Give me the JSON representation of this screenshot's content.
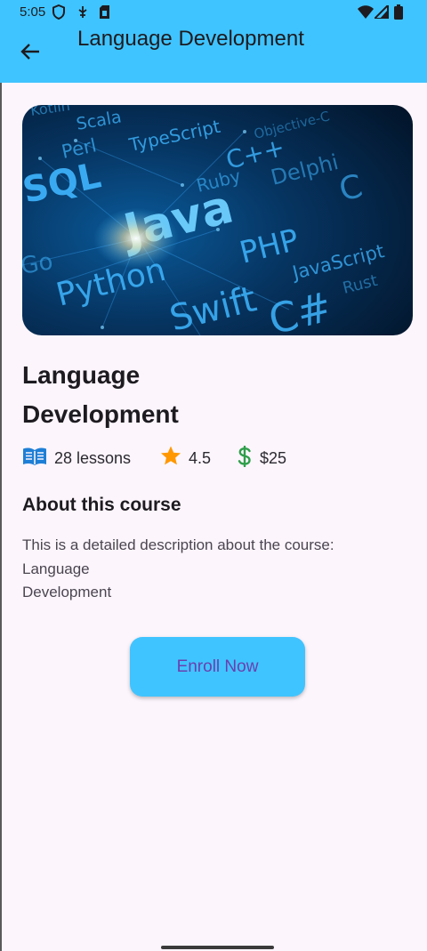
{
  "status_bar": {
    "time": "5:05",
    "icons": [
      "vpn-shield-icon",
      "usb-debug-icon",
      "sim-card-icon",
      "wifi-icon",
      "signal-icon",
      "battery-icon"
    ]
  },
  "app_bar": {
    "back_icon": "arrow-back-icon",
    "title": "Language Development"
  },
  "hero_image": {
    "keywords": [
      "Scala",
      "Perl",
      "TypeScript",
      "C++",
      "SQL",
      "Ruby",
      "Delphi",
      "C",
      "Java",
      "PHP",
      "JavaScript",
      "Go",
      "Python",
      "Swift",
      "C#",
      "Rust",
      "Kotlin",
      "Objective-C"
    ]
  },
  "course": {
    "title": "Language Development",
    "lessons": "28 lessons",
    "rating": "4.5",
    "price": "$25"
  },
  "about": {
    "heading": "About this course",
    "description": "This is a detailed description about the course: Language\nDevelopment"
  },
  "actions": {
    "enroll_label": "Enroll Now"
  },
  "colors": {
    "app_bar": "#40c4ff",
    "background": "#fcf5fc",
    "button": "#40c4ff",
    "button_text": "#6a3fb0",
    "book_icon": "#1e7fd6",
    "star_icon": "#ff9800",
    "dollar_icon": "#2e9e4a"
  }
}
